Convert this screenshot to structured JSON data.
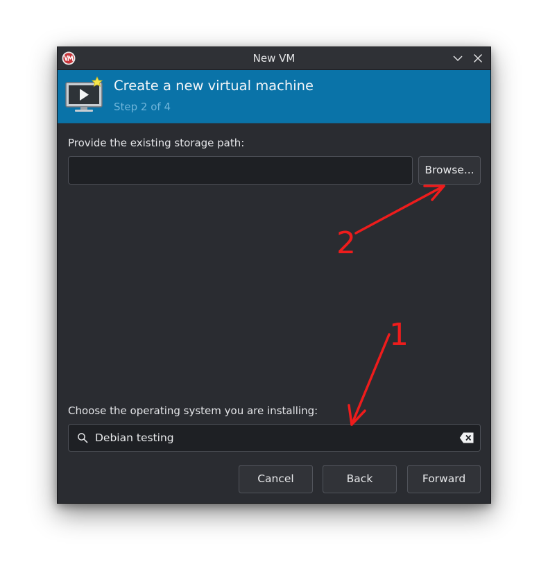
{
  "window": {
    "title": "New VM",
    "app_icon": "virt-manager-logo",
    "minimize_icon": "chevron-down-icon",
    "close_icon": "close-icon"
  },
  "banner": {
    "title": "Create a new virtual machine",
    "subtitle": "Step 2 of 4",
    "icon": "monitor-play-icon"
  },
  "storage": {
    "label": "Provide the existing storage path:",
    "value": "",
    "placeholder": "",
    "browse_label": "Browse..."
  },
  "os": {
    "label": "Choose the operating system you are installing:",
    "search_value": "Debian testing",
    "search_icon": "search-icon",
    "clear_icon": "clear-text-icon"
  },
  "buttons": {
    "cancel": "Cancel",
    "back": "Back",
    "forward": "Forward"
  },
  "annotations": {
    "one": "1",
    "two": "2",
    "color": "#ee1c1c"
  },
  "colors": {
    "banner": "#0a73a8",
    "window_bg": "#2a2c31",
    "field_bg": "#1e2024"
  }
}
